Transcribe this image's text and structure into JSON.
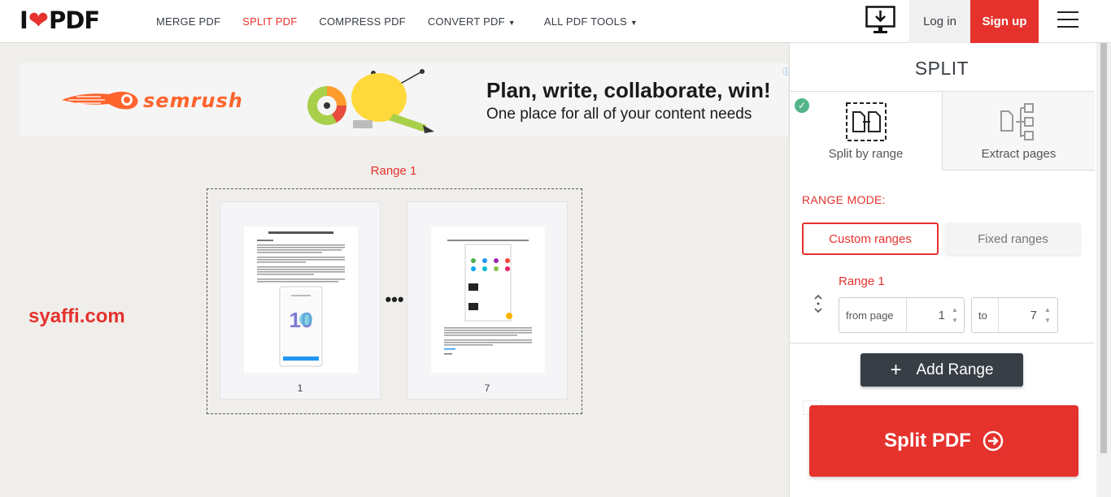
{
  "header": {
    "logo_left": "I",
    "logo_right": "PDF",
    "nav": {
      "merge": "MERGE PDF",
      "split": "SPLIT PDF",
      "compress": "COMPRESS PDF",
      "convert": "CONVERT PDF",
      "all_tools": "ALL PDF TOOLS"
    },
    "login": "Log in",
    "signup": "Sign up"
  },
  "ad": {
    "brand": "semrush",
    "title": "Plan, write, collaborate, win!",
    "subtitle": "One place for all of your content needs"
  },
  "watermark": "syaffi.com",
  "preview": {
    "range_label": "Range 1",
    "first_page": "1",
    "last_page": "7",
    "ellipsis": "•••"
  },
  "sidebar": {
    "title": "SPLIT",
    "modes": {
      "split_by_range": "Split by range",
      "extract_pages": "Extract pages"
    },
    "range_mode_label": "RANGE MODE:",
    "custom_ranges": "Custom ranges",
    "fixed_ranges": "Fixed ranges",
    "range1": {
      "label": "Range 1",
      "from_label": "from page",
      "from_value": "1",
      "to_label": "to",
      "to_value": "7"
    },
    "add_range": "Add Range",
    "split_button": "Split PDF"
  },
  "colors": {
    "brand_red": "#e5322d",
    "dark": "#383e45",
    "success": "#55b58a"
  }
}
